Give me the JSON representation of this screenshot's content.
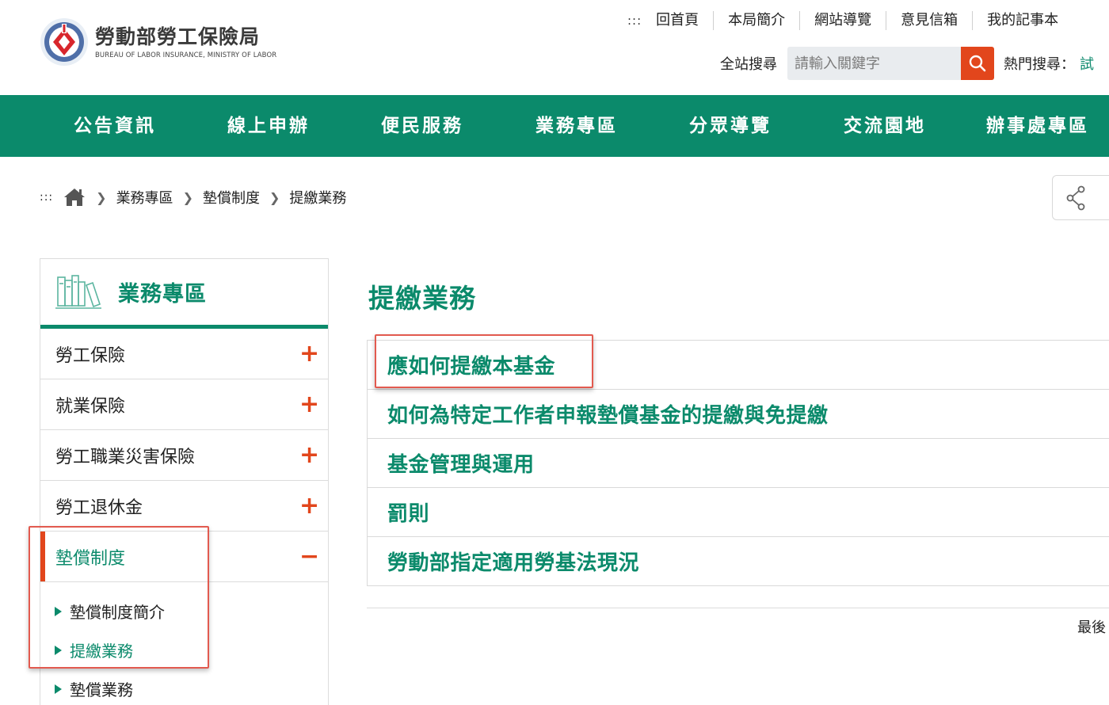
{
  "header": {
    "logo_title": "勞動部勞工保險局",
    "logo_subtitle": "BUREAU OF LABOR INSURANCE, MINISTRY OF LABOR",
    "top_links_dots": ":::",
    "top_links": [
      "回首頁",
      "本局簡介",
      "網站導覽",
      "意見信箱",
      "我的記事本"
    ],
    "search_label": "全站搜尋",
    "search_placeholder": "請輸入關鍵字",
    "hot_label": "熱門搜尋：",
    "hot_term": "試"
  },
  "main_nav": [
    "公告資訊",
    "線上申辦",
    "便民服務",
    "業務專區",
    "分眾導覽",
    "交流園地",
    "辦事處專區"
  ],
  "breadcrumb": {
    "dots": ":::",
    "items": [
      "業務專區",
      "墊償制度",
      "提繳業務"
    ]
  },
  "sidebar": {
    "title": "業務專區",
    "items": [
      {
        "label": "勞工保險",
        "toggle": "+"
      },
      {
        "label": "就業保險",
        "toggle": "+"
      },
      {
        "label": "勞工職業災害保險",
        "toggle": "+"
      },
      {
        "label": "勞工退休金",
        "toggle": "+"
      },
      {
        "label": "墊償制度",
        "toggle": "−"
      }
    ],
    "sub_items": [
      "墊償制度簡介",
      "提繳業務",
      "墊償業務"
    ]
  },
  "content": {
    "title": "提繳業務",
    "links": [
      "應如何提繳本基金",
      "如何為特定工作者申報墊償基金的提繳與免提繳",
      "基金管理與運用",
      "罰則",
      "勞動部指定適用勞基法現況"
    ],
    "last_update": "最後"
  },
  "colors": {
    "primary_green": "#0b8a6b",
    "accent_orange": "#e2461c",
    "annotation_red": "#e25a4f"
  }
}
